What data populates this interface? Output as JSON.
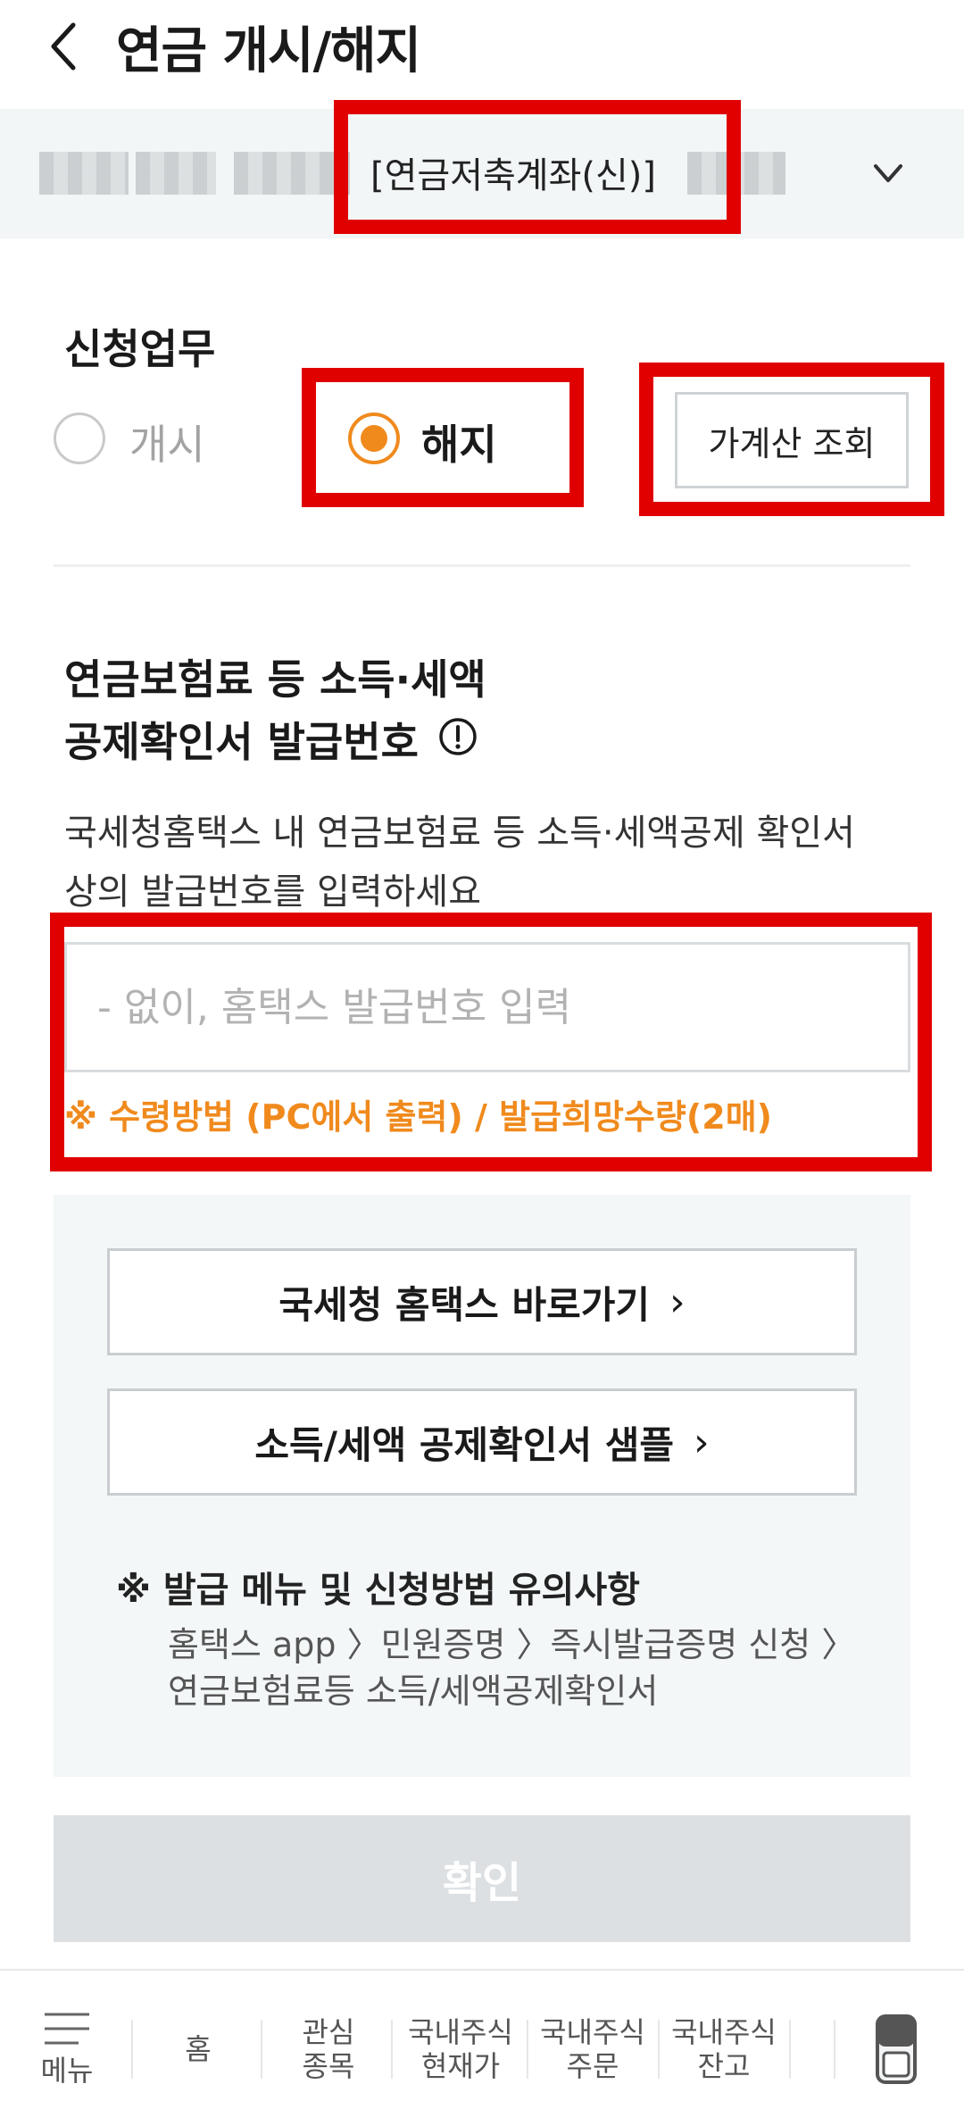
{
  "header": {
    "title": "연금 개시/해지"
  },
  "account": {
    "name": "[연금저축계좌(신)]"
  },
  "application": {
    "section_label": "신청업무",
    "option_start": "개시",
    "option_cancel": "해지",
    "selected": "해지",
    "estimate_button": "가계산 조회"
  },
  "form": {
    "title_line1": "연금보험료 등 소득·세액",
    "title_line2": "공제확인서 발급번호",
    "desc_line1": "국세청홈택스 내 연금보험료 등 소득·세액공제 확인서",
    "desc_line2": "상의 발급번호를 입력하세요",
    "input_value": "",
    "input_placeholder": "- 없이, 홈택스 발급번호 입력",
    "note": "※ 수령방법 (PC에서 출력) / 발급희망수량(2매)"
  },
  "guide": {
    "hometax_button": "국세청 홈택스 바로가기",
    "sample_button": "소득/세액 공제확인서 샘플",
    "title": "※ 발급 메뉴 및 신청방법 유의사항",
    "path_line1": "홈택스 app 〉민원증명 〉즉시발급증명 신청 〉",
    "path_line2": "연금보험료등 소득/세액공제확인서"
  },
  "confirm_button": "확인",
  "bottom_nav": {
    "menu": "메뉴",
    "home": "홈",
    "watch_line1": "관심",
    "watch_line2": "종목",
    "price_line1": "국내주식",
    "price_line2": "현재가",
    "order_line1": "국내주식",
    "order_line2": "주문",
    "balance_line1": "국내주식",
    "balance_line2": "잔고"
  },
  "colors": {
    "accent": "#f08a1d",
    "highlight": "#e00000",
    "disabled": "#dde0e3"
  },
  "icons": [
    "back-icon",
    "chevron-down-icon",
    "info-icon",
    "menu-icon",
    "phone-icon"
  ]
}
